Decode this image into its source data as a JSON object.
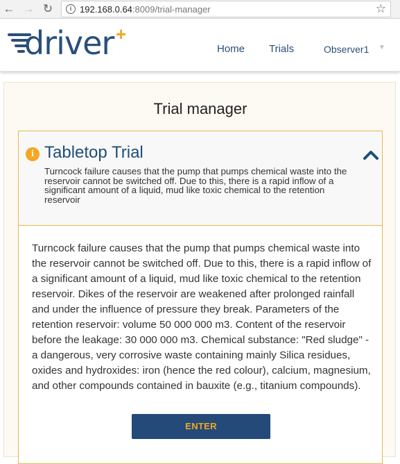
{
  "browser": {
    "url_host": "192.168.0.64",
    "url_rest": ":8009/trial-manager"
  },
  "header": {
    "logo_text": "driver",
    "logo_plus": "+",
    "nav": {
      "home": "Home",
      "trials": "Trials",
      "observer": "Observer1"
    }
  },
  "page": {
    "title": "Trial manager"
  },
  "trial": {
    "title": "Tabletop Trial",
    "summary": "Turncock failure causes that the pump that pumps chemical waste into the reservoir cannot be switched off. Due to this, there is a rapid inflow of a significant amount of a liquid, mud like toxic chemical to the retention reservoir",
    "description": "Turncock failure causes that the pump that pumps chemical waste into the reservoir cannot be switched off. Due to this, there is a rapid inflow of a significant amount of a liquid, mud like toxic chemical to the retention reservoir. Dikes of the reservoir are weakened after prolonged rainfall and under the influence of pressure they break. Parameters of the retention reservoir: volume 50 000 000 m3. Content of the reservoir before the leakage: 30 000 000 m3. Chemical substance: \"Red sludge\" - a dangerous, very corrosive waste containing mainly Silica residues, oxides and hydroxides: iron (hence the red colour), calcium, magnesium, and other compounds contained in bauxite (e.g., titanium compounds).",
    "enter_label": "ENTER"
  },
  "colors": {
    "brand_blue": "#1f4e79",
    "accent_orange": "#f5a623",
    "button_bg": "#234a78"
  }
}
